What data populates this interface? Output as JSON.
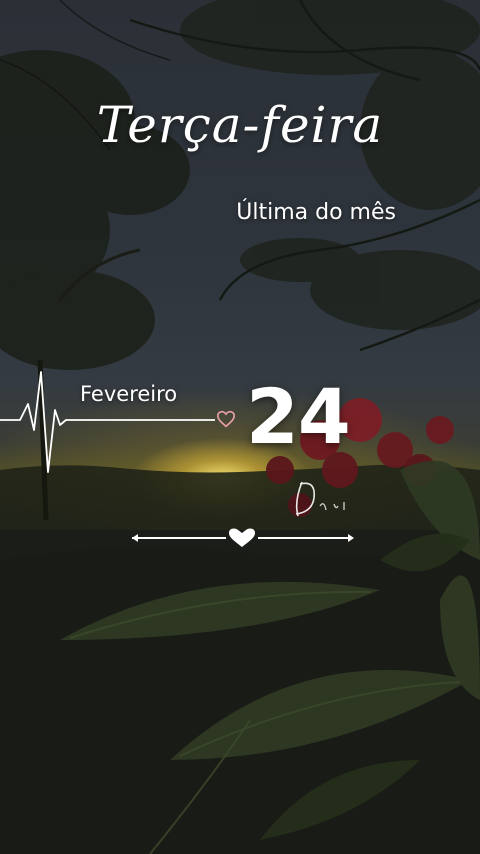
{
  "greeting": {
    "weekday": "Terça-feira",
    "note": "Última do mês"
  },
  "date": {
    "month": "Fevereiro",
    "day": "24"
  },
  "decor": {
    "heartbeat_icon": "heartbeat-line-icon",
    "heart_outline_icon": "heart-outline-icon",
    "arrow_divider_icon": "double-arrow-heart-icon",
    "signature_scribble": "Dri"
  },
  "colors": {
    "text": "#ffffff",
    "heart_outline": "#e8a0a8",
    "sun": "#f5e07a"
  }
}
